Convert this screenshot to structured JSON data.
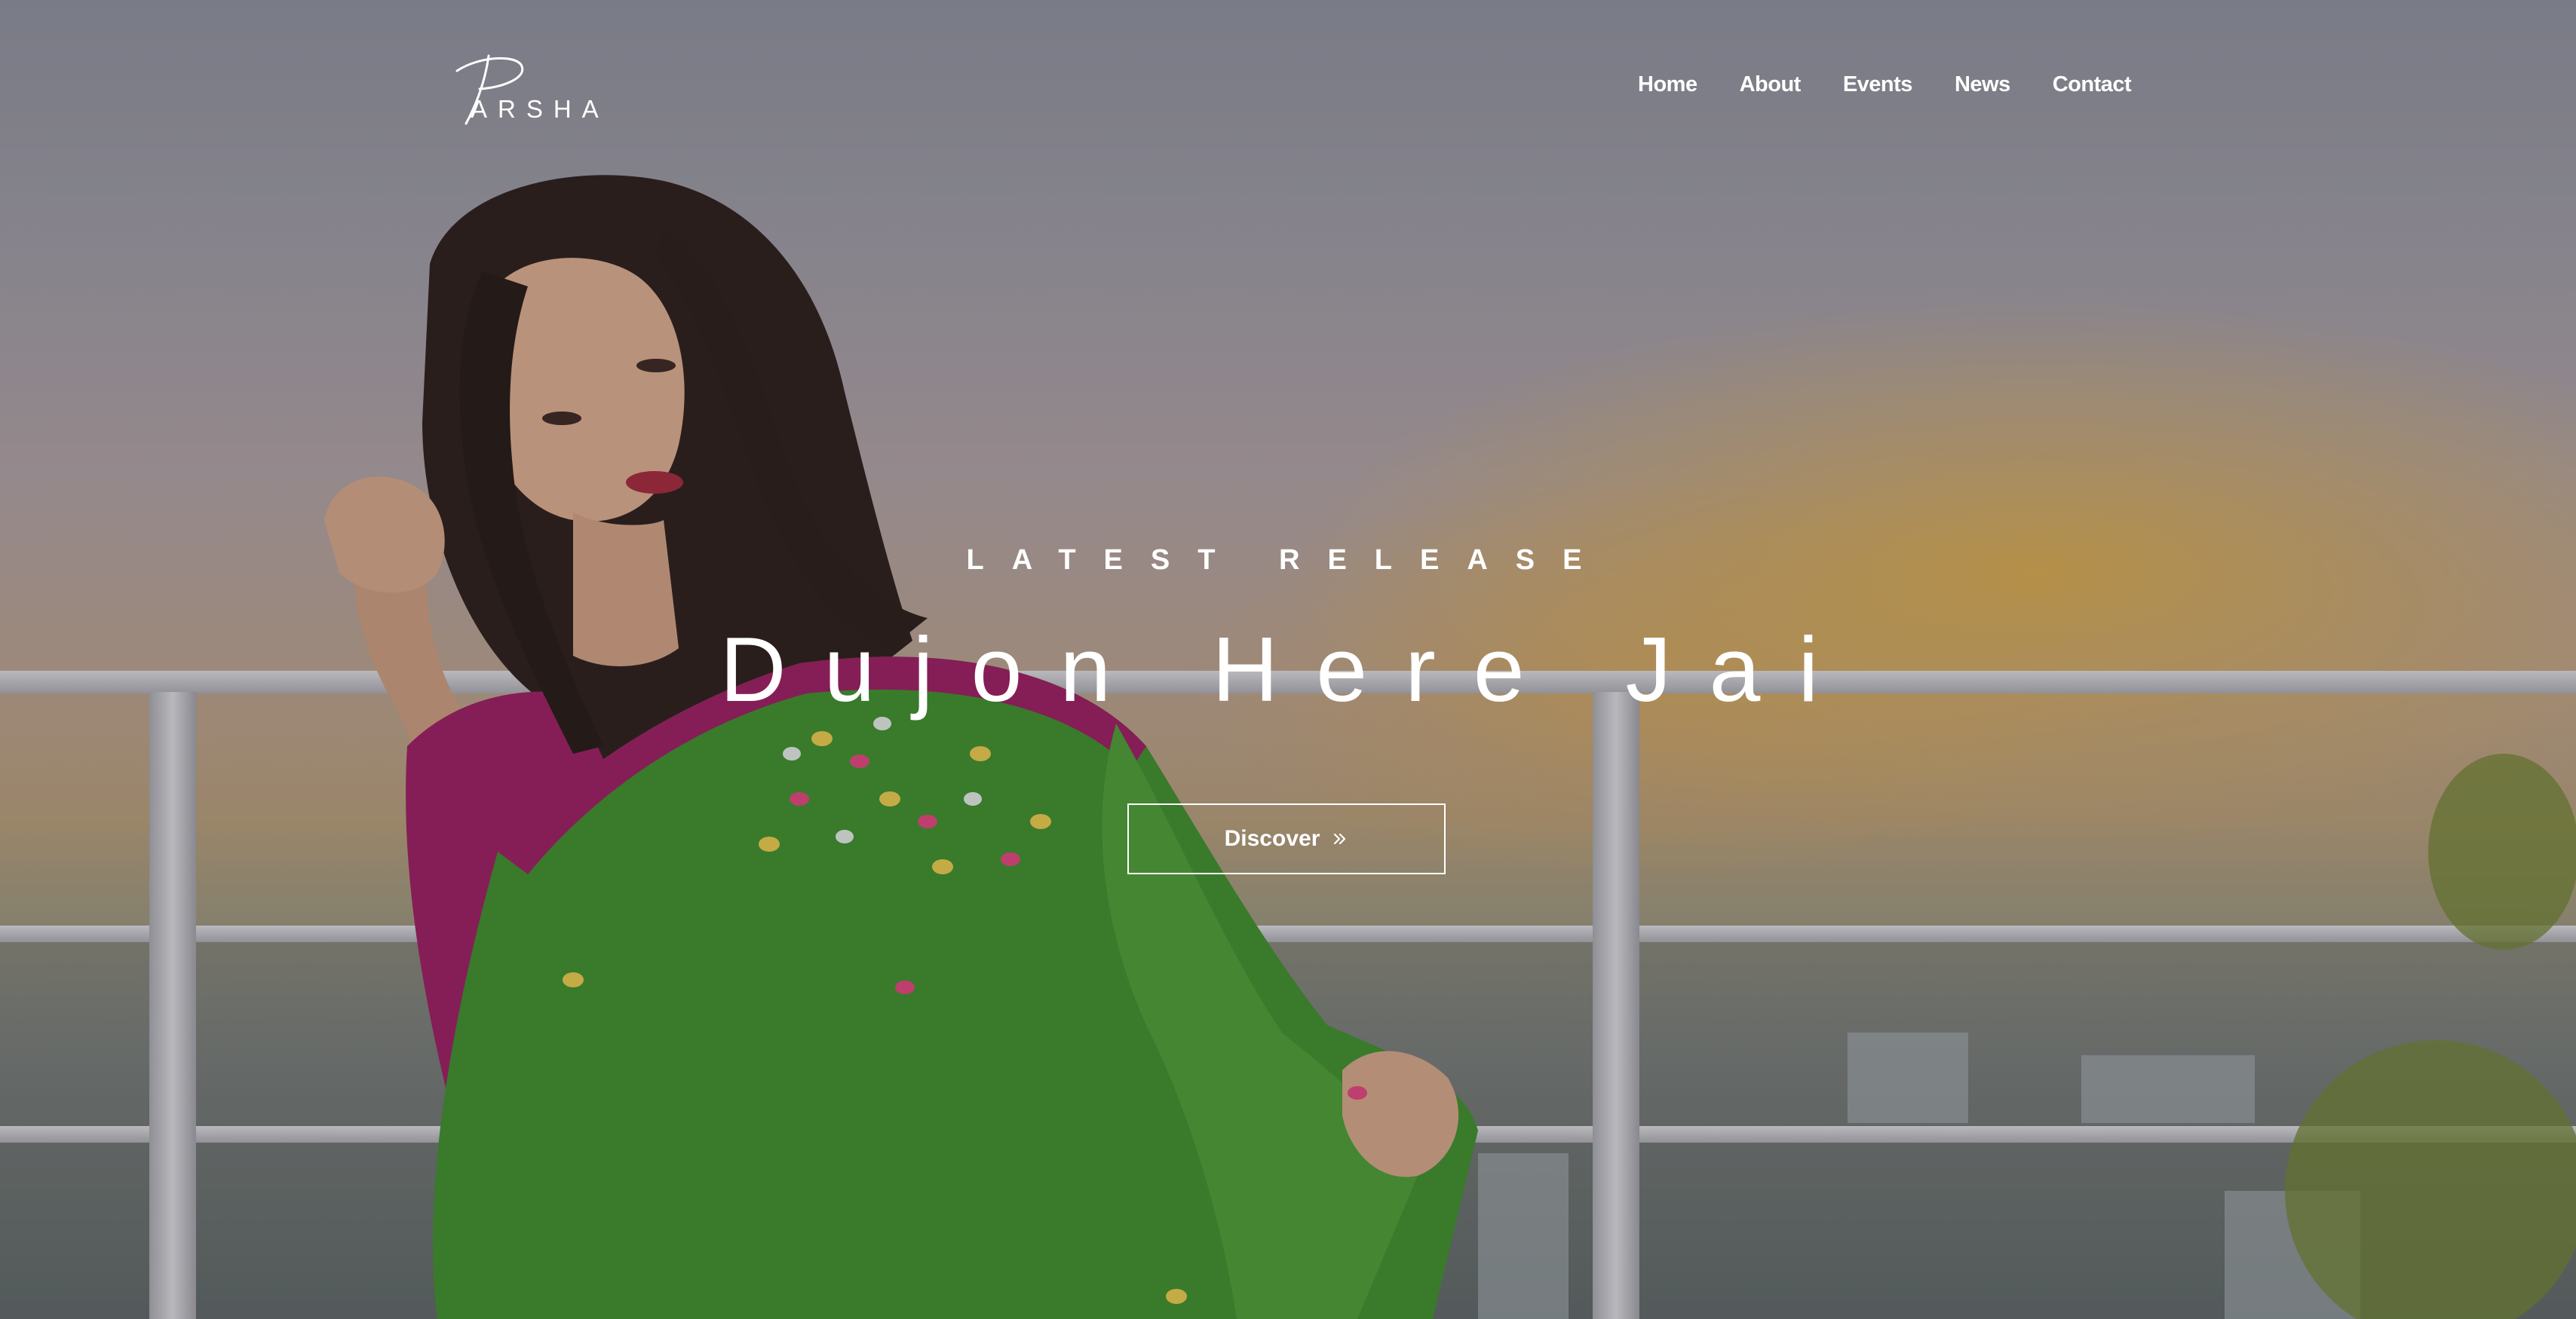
{
  "header": {
    "logo_text": "ARSHA",
    "nav": [
      {
        "label": "Home"
      },
      {
        "label": "About"
      },
      {
        "label": "Events"
      },
      {
        "label": "News"
      },
      {
        "label": "Contact"
      }
    ]
  },
  "hero": {
    "eyebrow": "LATEST RELEASE",
    "title": "Dujon Here Jai",
    "cta_label": "Discover",
    "cta_icon": "double-chevron-right-icon"
  },
  "colors": {
    "text": "#ffffff",
    "saree_green": "#3f8d2a",
    "blouse_magenta": "#9a1d5e",
    "sky_gold": "#d6a84a"
  }
}
